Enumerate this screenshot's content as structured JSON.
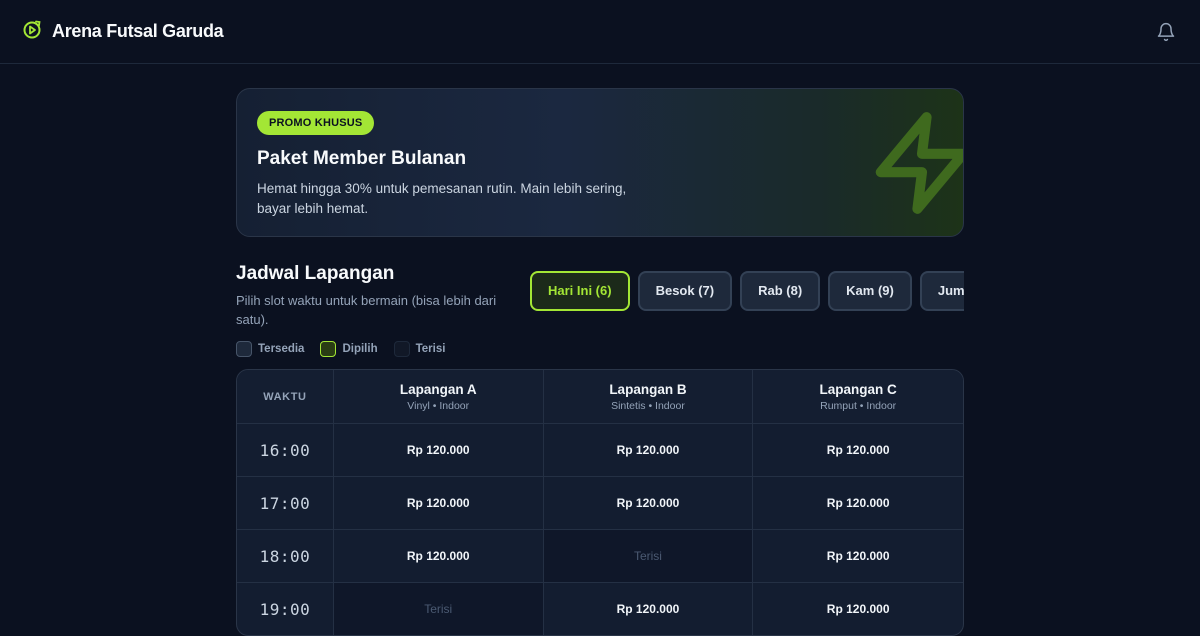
{
  "app": {
    "title": "Arena Futsal Garuda",
    "accent": "#a3e635"
  },
  "promo": {
    "badge": "PROMO KHUSUS",
    "title": "Paket Member Bulanan",
    "text": "Hemat hingga 30% untuk pemesanan rutin. Main lebih sering, bayar lebih hemat."
  },
  "schedule": {
    "title": "Jadwal Lapangan",
    "subtitle": "Pilih slot waktu untuk bermain (bisa lebih dari satu).",
    "days": [
      {
        "label": "Hari Ini (6)",
        "active": true
      },
      {
        "label": "Besok (7)",
        "active": false
      },
      {
        "label": "Rab (8)",
        "active": false
      },
      {
        "label": "Kam (9)",
        "active": false
      },
      {
        "label": "Jum",
        "active": false
      }
    ],
    "legend": {
      "available": "Tersedia",
      "selected": "Dipilih",
      "booked": "Terisi"
    }
  },
  "grid": {
    "time_header": "WAKTU",
    "courts": [
      {
        "name": "Lapangan A",
        "meta": "Vinyl • Indoor"
      },
      {
        "name": "Lapangan B",
        "meta": "Sintetis • Indoor"
      },
      {
        "name": "Lapangan C",
        "meta": "Rumput • Indoor"
      }
    ],
    "rows": [
      {
        "time": "16:00",
        "slots": [
          "Rp 120.000",
          "Rp 120.000",
          "Rp 120.000"
        ]
      },
      {
        "time": "17:00",
        "slots": [
          "Rp 120.000",
          "Rp 120.000",
          "Rp 120.000"
        ]
      },
      {
        "time": "18:00",
        "slots": [
          "Rp 120.000",
          "Terisi",
          "Rp 120.000"
        ]
      },
      {
        "time": "19:00",
        "slots": [
          "Terisi",
          "Rp 120.000",
          "Rp 120.000"
        ]
      }
    ]
  }
}
